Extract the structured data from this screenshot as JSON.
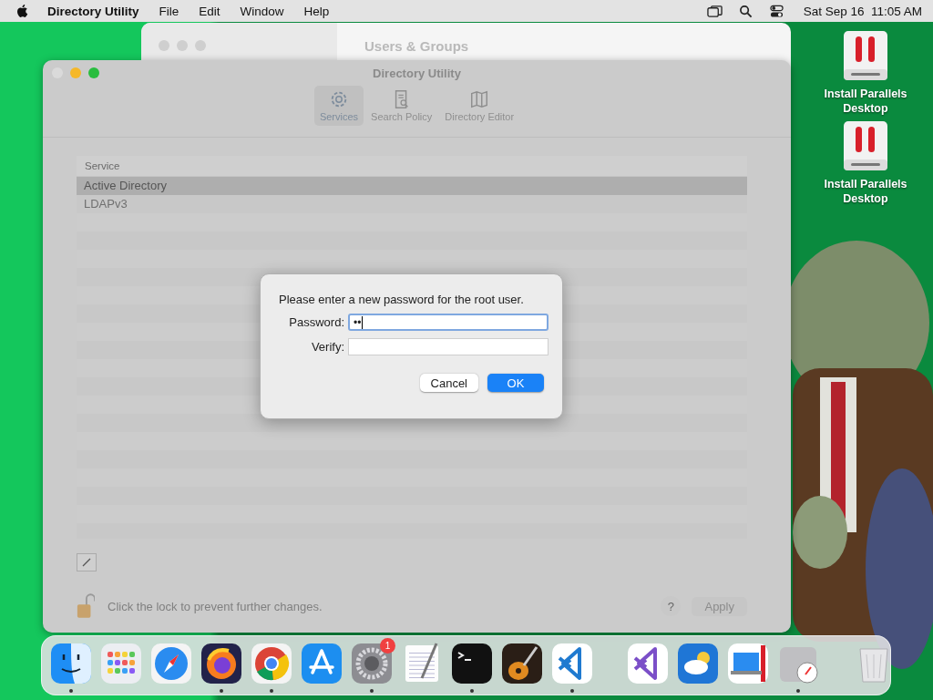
{
  "menu_bar": {
    "app_name": "Directory Utility",
    "menus": [
      "File",
      "Edit",
      "Window",
      "Help"
    ],
    "clock": "Sat Sep 16  11:05 AM"
  },
  "background_window": {
    "title": "Users & Groups"
  },
  "window": {
    "title": "Directory Utility",
    "tabs": [
      {
        "label": "Services",
        "kind": "gear",
        "selected": true
      },
      {
        "label": "Search Policy",
        "kind": "document",
        "selected": false
      },
      {
        "label": "Directory Editor",
        "kind": "map",
        "selected": false
      }
    ],
    "table": {
      "columns": [
        "Service"
      ],
      "rows": [
        {
          "name": "Active Directory",
          "selected": true
        },
        {
          "name": "LDAPv3",
          "selected": false
        }
      ]
    },
    "lock_text": "Click the lock to prevent further changes.",
    "help": "?",
    "apply_button": {
      "label": "Apply",
      "disabled": true
    }
  },
  "dialog": {
    "message": "Please enter a new password for the root user.",
    "fields": [
      {
        "label": "Password:",
        "value": "••",
        "focused": true
      },
      {
        "label": "Verify:",
        "focused": false
      }
    ],
    "buttons": [
      {
        "label": "Cancel",
        "default": false
      },
      {
        "label": "OK",
        "default": true
      }
    ]
  },
  "desktop_icons": [
    {
      "label": "Install Parallels Desktop"
    },
    {
      "label": "Install Parallels Desktop"
    }
  ],
  "dock": {
    "apps": [
      {
        "kind": "finder",
        "running": true
      },
      {
        "kind": "launchpad",
        "running": false
      },
      {
        "kind": "safari",
        "running": false
      },
      {
        "kind": "firefox",
        "running": true
      },
      {
        "kind": "chrome",
        "running": true
      },
      {
        "kind": "appstore",
        "running": false
      },
      {
        "kind": "settings",
        "running": true,
        "badge": "1"
      },
      {
        "kind": "textedit",
        "running": false
      },
      {
        "kind": "terminal",
        "running": true
      },
      {
        "kind": "garageband",
        "running": false
      },
      {
        "kind": "vscode",
        "running": true
      },
      {
        "kind": "separator"
      },
      {
        "kind": "visualstudio",
        "running": false
      },
      {
        "kind": "weather",
        "running": false
      },
      {
        "kind": "parallels",
        "running": false
      },
      {
        "kind": "utilities",
        "running": true
      },
      {
        "kind": "separator"
      },
      {
        "kind": "trash",
        "running": false
      }
    ]
  }
}
